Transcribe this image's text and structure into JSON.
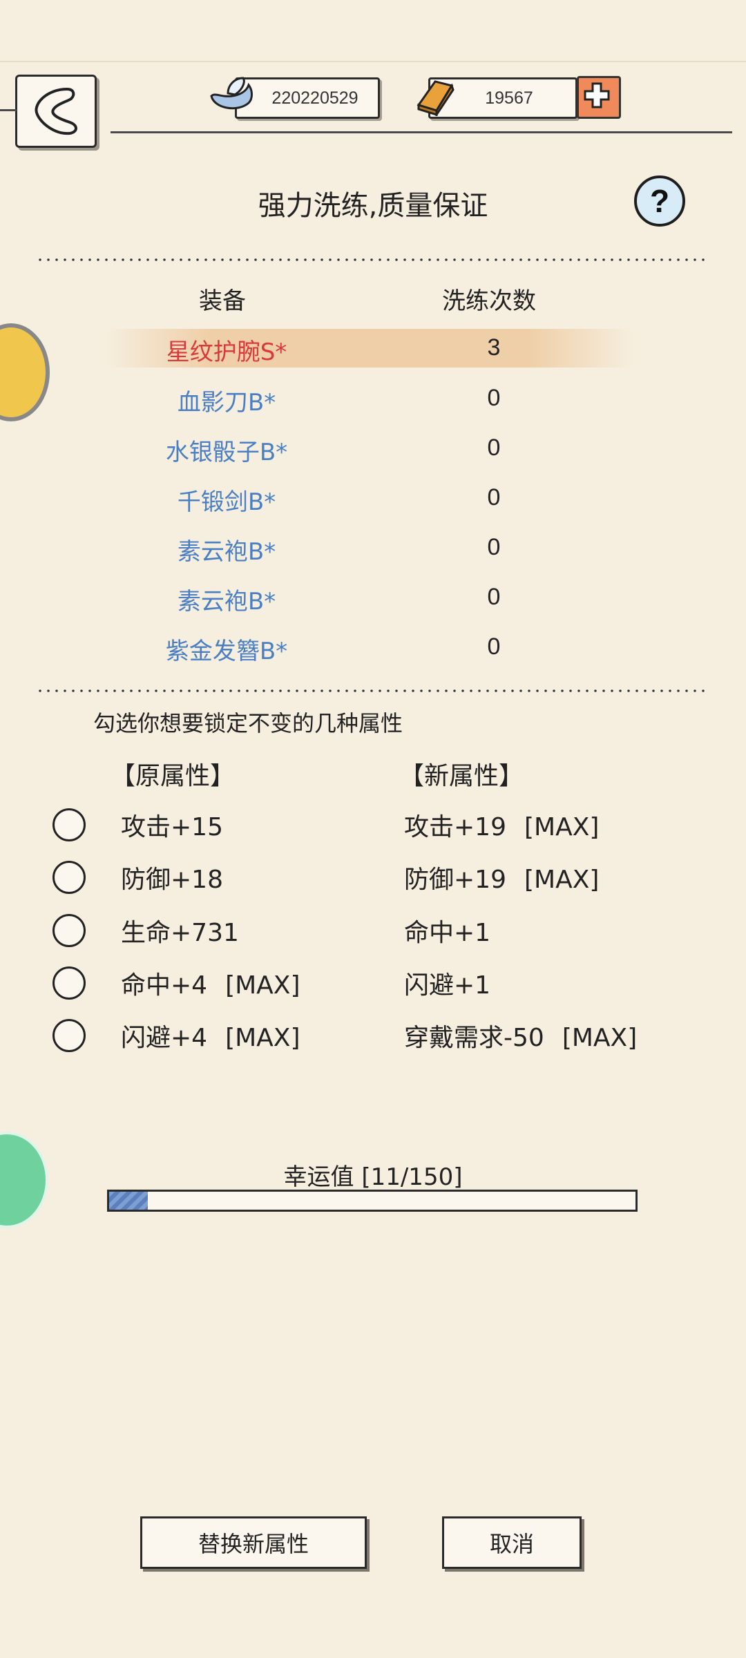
{
  "header": {
    "silver_amount": "220220529",
    "gold_amount": "19567"
  },
  "title": "强力洗练,质量保证",
  "help_label": "?",
  "table": {
    "col_equip": "装备",
    "col_count": "洗练次数",
    "rows": [
      {
        "name": "星纹护腕S*",
        "count": "3",
        "color": "#d83a3a",
        "selected": true
      },
      {
        "name": "血影刀B*",
        "count": "0",
        "color": "#4a7fc4"
      },
      {
        "name": "水银骰子B*",
        "count": "0",
        "color": "#4a7fc4"
      },
      {
        "name": "千锻剑B*",
        "count": "0",
        "color": "#4a7fc4"
      },
      {
        "name": "素云袍B*",
        "count": "0",
        "color": "#4a7fc4"
      },
      {
        "name": "素云袍B*",
        "count": "0",
        "color": "#4a7fc4"
      },
      {
        "name": "紫金发簪B*",
        "count": "0",
        "color": "#4a7fc4"
      }
    ]
  },
  "lock_hint": "勾选你想要锁定不变的几种属性",
  "attributes": {
    "old_head": "【原属性】",
    "new_head": "【新属性】",
    "old": [
      {
        "text": "攻击+15",
        "max": ""
      },
      {
        "text": "防御+18",
        "max": ""
      },
      {
        "text": "生命+731",
        "max": ""
      },
      {
        "text": "命中+4",
        "max": "[MAX]"
      },
      {
        "text": "闪避+4",
        "max": "[MAX]"
      }
    ],
    "new": [
      {
        "text": "攻击+19",
        "max": "[MAX]"
      },
      {
        "text": "防御+19",
        "max": "[MAX]"
      },
      {
        "text": "命中+1",
        "max": ""
      },
      {
        "text": "闪避+1",
        "max": ""
      },
      {
        "text": "穿戴需求-50",
        "max": "[MAX]"
      }
    ]
  },
  "luck": {
    "label": "幸运值 [11/150]",
    "current": 11,
    "max": 150
  },
  "buttons": {
    "replace": "替换新属性",
    "cancel": "取消"
  }
}
